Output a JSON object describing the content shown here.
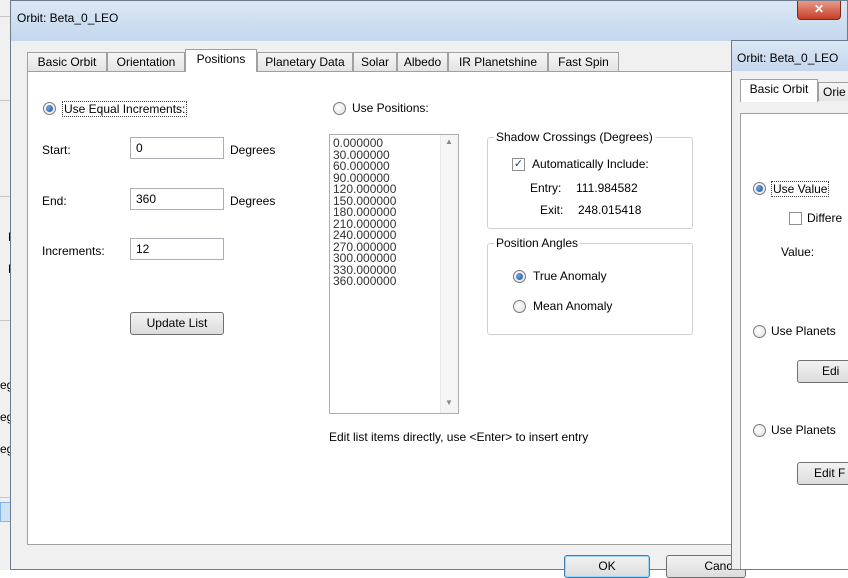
{
  "bg_window": {
    "labels": [
      "D",
      "D",
      "egr",
      "egr",
      "egr"
    ]
  },
  "dialog": {
    "title": "Orbit: Beta_0_LEO",
    "close": "✕",
    "tabs": [
      "Basic Orbit",
      "Orientation",
      "Positions",
      "Planetary Data",
      "Solar",
      "Albedo",
      "IR Planetshine",
      "Fast Spin"
    ],
    "active_tab": "Positions",
    "equal": {
      "radio_label": "Use Equal Increments:",
      "start_label": "Start:",
      "start_value": "0",
      "end_label": "End:",
      "end_value": "360",
      "increments_label": "Increments:",
      "increments_value": "12",
      "unit": "Degrees",
      "update_button": "Update List"
    },
    "positions": {
      "radio_label": "Use Positions:",
      "list": [
        "0.000000",
        "30.000000",
        "60.000000",
        "90.000000",
        "120.000000",
        "150.000000",
        "180.000000",
        "210.000000",
        "240.000000",
        "270.000000",
        "300.000000",
        "330.000000",
        "360.000000"
      ],
      "hint": "Edit list items directly, use <Enter> to insert entry"
    },
    "shadow": {
      "title": "Shadow Crossings (Degrees)",
      "auto_label": "Automatically Include:",
      "entry_label": "Entry:",
      "entry_value": "111.984582",
      "exit_label": "Exit:",
      "exit_value": "248.015418"
    },
    "angles": {
      "title": "Position Angles",
      "true_label": "True Anomaly",
      "mean_label": "Mean Anomaly"
    },
    "ok_button": "OK",
    "cancel_button": "Cance"
  },
  "dialog2": {
    "title": "Orbit: Beta_0_LEO",
    "tabs": [
      "Basic Orbit",
      "Orie"
    ],
    "use_value": "Use Value",
    "differ": "Differe",
    "value_label": "Value:",
    "use_planets1": "Use Planets",
    "edit1": "Edi",
    "use_planets2": "Use Planets",
    "edit2": "Edit F"
  }
}
